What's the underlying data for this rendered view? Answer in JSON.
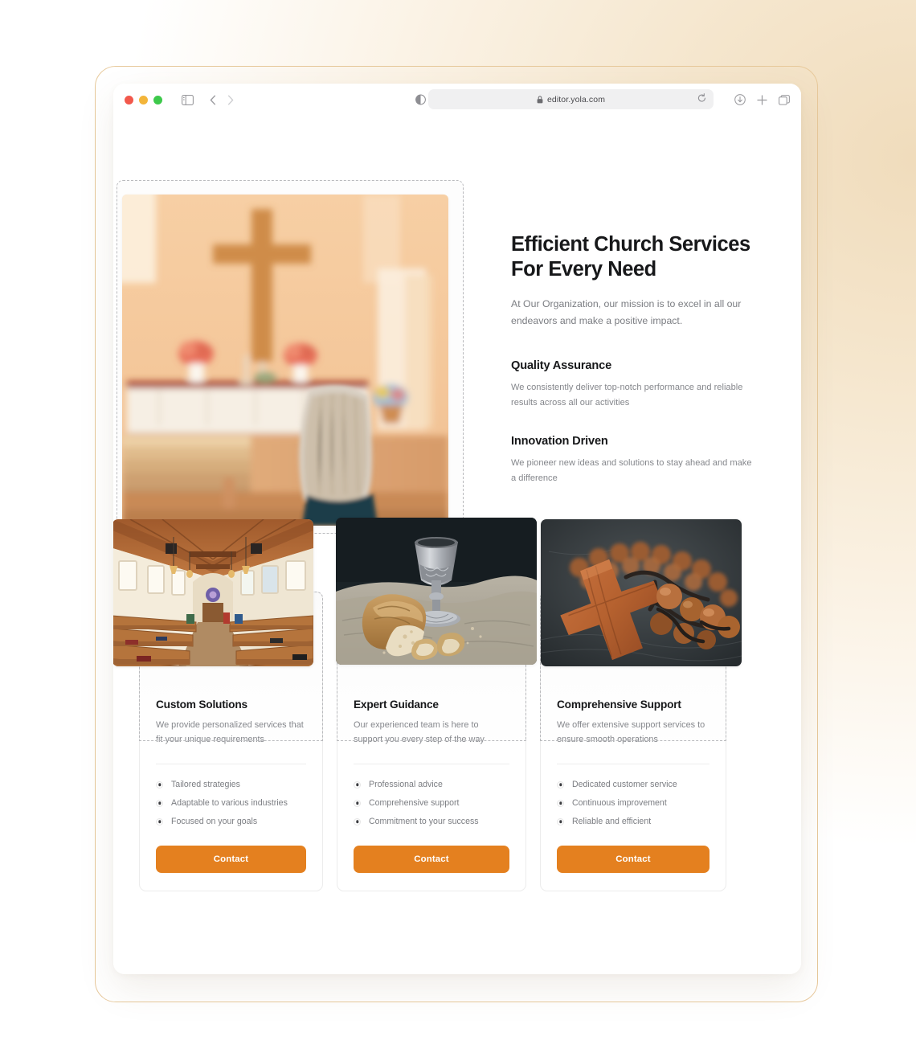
{
  "browser": {
    "url": "editor.yola.com",
    "lock_icon": "lock-icon",
    "reload_icon": "reload-icon",
    "sidebar_icon": "sidebar-toggle-icon",
    "back_icon": "chevron-left-icon",
    "forward_icon": "chevron-right-icon",
    "reader_icon": "reader-view-icon",
    "downloads_icon": "downloads-icon",
    "new_tab_icon": "plus-icon",
    "tab_overview_icon": "tab-overview-icon",
    "traffic_lights": [
      "close",
      "minimize",
      "zoom"
    ]
  },
  "theme": {
    "accent": "#e4801f",
    "heading": "#17181a",
    "body_text": "#85878c",
    "card_border": "#ececec",
    "selection_dash": "#b9babd"
  },
  "hero": {
    "title": "Efficient Church Services For Every Need",
    "subtitle": "At Our Organization, our mission is to excel in all our endeavors and make a positive impact.",
    "image_alt": "woman seated in church pew facing wooden cross above altar",
    "features": [
      {
        "title": "Quality Assurance",
        "desc": "We consistently deliver top-notch performance and reliable results across all our activities"
      },
      {
        "title": "Innovation Driven",
        "desc": "We pioneer new ideas and solutions to stay ahead and make a difference"
      }
    ]
  },
  "cards": [
    {
      "image_alt": "church interior with wooden pews and timber ceiling",
      "title": "Custom Solutions",
      "desc": "We provide personalized services that fit your unique requirements",
      "bullets": [
        "Tailored strategies",
        "Adaptable to various industries",
        "Focused on your goals"
      ],
      "button": "Contact"
    },
    {
      "image_alt": "bread loaf and silver communion chalice on linen cloth",
      "title": "Expert Guidance",
      "desc": "Our experienced team is here to support you every step of the way",
      "bullets": [
        "Professional advice",
        "Comprehensive support",
        "Commitment to your success"
      ],
      "button": "Contact"
    },
    {
      "image_alt": "wooden cross with rosary beads on dark leather",
      "title": "Comprehensive Support",
      "desc": "We offer extensive support services to ensure smooth operations",
      "bullets": [
        "Dedicated customer service",
        "Continuous improvement",
        "Reliable and efficient"
      ],
      "button": "Contact"
    }
  ]
}
